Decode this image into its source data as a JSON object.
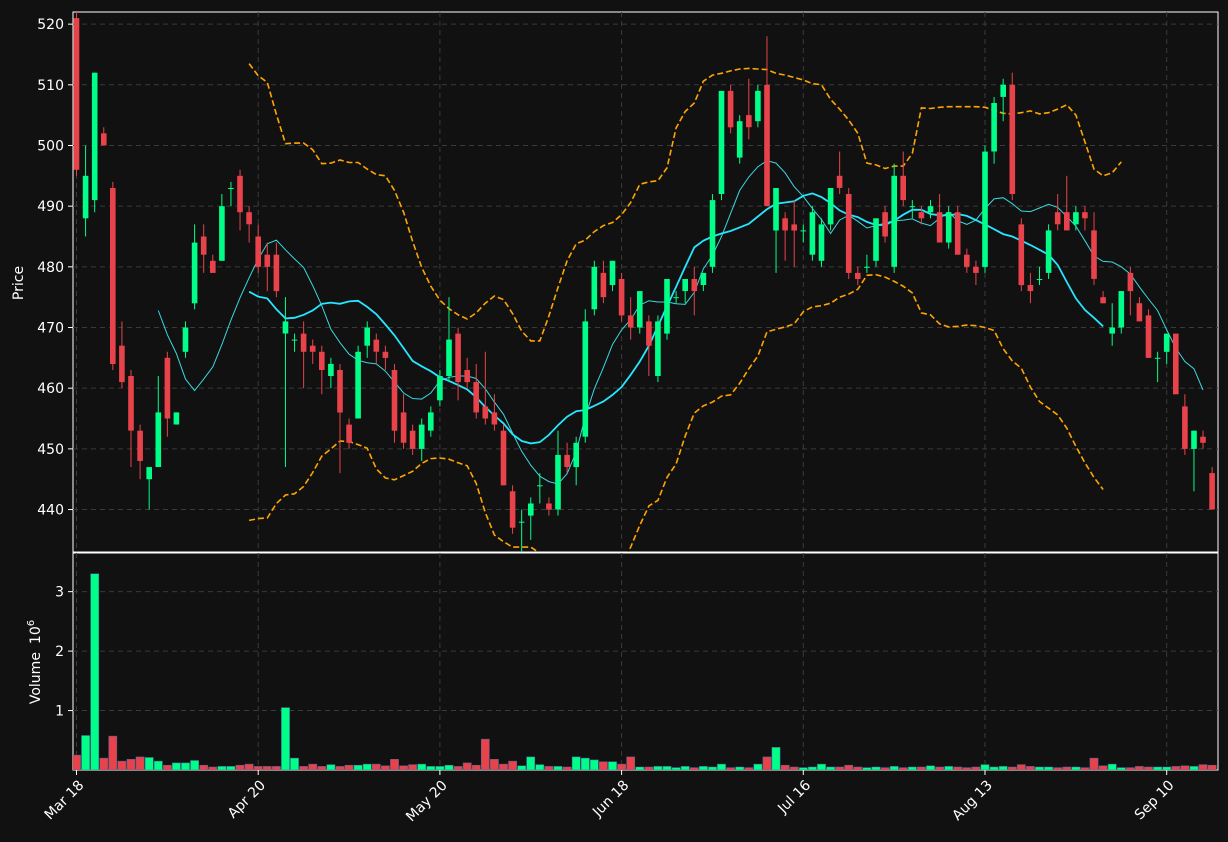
{
  "chart_data": {
    "type": "candlestick",
    "colors": {
      "background": "#111111",
      "up": "#00ff88",
      "down": "#e8434b",
      "ma_fast": "#3ad8e0",
      "ma_slow": "#27e6ff",
      "band": "#ffa500",
      "grid": "#3a3a3a",
      "axis": "#ffffff"
    },
    "price_panel": {
      "ylabel": "Price",
      "ylim": [
        433,
        522
      ],
      "yticks": [
        440,
        450,
        460,
        470,
        480,
        490,
        500,
        510,
        520
      ],
      "grid": true
    },
    "volume_panel": {
      "ylabel": "Volume",
      "ylabel_exponent": "6",
      "ylim": [
        0,
        3.65
      ],
      "yticks": [
        1,
        2,
        3
      ],
      "grid": true
    },
    "x_ticks": [
      {
        "index": 0,
        "label": "Mar 18"
      },
      {
        "index": 20,
        "label": "Apr 20"
      },
      {
        "index": 40,
        "label": "May 20"
      },
      {
        "index": 60,
        "label": "Jun 18"
      },
      {
        "index": 80,
        "label": "Jul 16"
      },
      {
        "index": 100,
        "label": "Aug 13"
      },
      {
        "index": 120,
        "label": "Sep 10"
      }
    ],
    "candles": [
      [
        521,
        522,
        495,
        496,
        0.25
      ],
      [
        488,
        500,
        485,
        495,
        0.58
      ],
      [
        491,
        512,
        489,
        512,
        3.3
      ],
      [
        502,
        503,
        500,
        500,
        0.2
      ],
      [
        493,
        494,
        463,
        464,
        0.57
      ],
      [
        467,
        471,
        460,
        461,
        0.15
      ],
      [
        462,
        463,
        447,
        453,
        0.18
      ],
      [
        453,
        454,
        445,
        448,
        0.22
      ],
      [
        445,
        447,
        440,
        447,
        0.21
      ],
      [
        447,
        462,
        447,
        456,
        0.15
      ],
      [
        465,
        466,
        452,
        455,
        0.08
      ],
      [
        454,
        456,
        454,
        456,
        0.12
      ],
      [
        466,
        471,
        465,
        470,
        0.12
      ],
      [
        474,
        487,
        473,
        484,
        0.16
      ],
      [
        485,
        487,
        479,
        482,
        0.08
      ],
      [
        481,
        482,
        479,
        479,
        0.05
      ],
      [
        481,
        492,
        481,
        490,
        0.06
      ],
      [
        493,
        494,
        490,
        493,
        0.06
      ],
      [
        495,
        496,
        486,
        489,
        0.08
      ],
      [
        489,
        490,
        484,
        487,
        0.1
      ],
      [
        485,
        487,
        479,
        480,
        0.06
      ],
      [
        482,
        484,
        476,
        480,
        0.06
      ],
      [
        482,
        484,
        475,
        476,
        0.06
      ],
      [
        469,
        475,
        447,
        471,
        1.05
      ],
      [
        468,
        469,
        466,
        468,
        0.2
      ],
      [
        469,
        471,
        460,
        466,
        0.06
      ],
      [
        467,
        468,
        464,
        466,
        0.1
      ],
      [
        466,
        467,
        459,
        463,
        0.06
      ],
      [
        462,
        465,
        460,
        464,
        0.09
      ],
      [
        463,
        464,
        446,
        456,
        0.06
      ],
      [
        454,
        455,
        450,
        451,
        0.08
      ],
      [
        455,
        467,
        455,
        466,
        0.08
      ],
      [
        467,
        471,
        465,
        470,
        0.1
      ],
      [
        468,
        469,
        464,
        466,
        0.1
      ],
      [
        466,
        467,
        463,
        465,
        0.07
      ],
      [
        463,
        464,
        451,
        453,
        0.18
      ],
      [
        456,
        459,
        450,
        451,
        0.07
      ],
      [
        453,
        454,
        449,
        450,
        0.09
      ],
      [
        450,
        455,
        448,
        454,
        0.1
      ],
      [
        453,
        457,
        452,
        456,
        0.06
      ],
      [
        458,
        463,
        457,
        462,
        0.06
      ],
      [
        462,
        475,
        461,
        468,
        0.08
      ],
      [
        469,
        470,
        458,
        461,
        0.06
      ],
      [
        463,
        465,
        460,
        461,
        0.12
      ],
      [
        461,
        464,
        455,
        456,
        0.08
      ],
      [
        457,
        466,
        454,
        455,
        0.52
      ],
      [
        456,
        459,
        453,
        454,
        0.18
      ],
      [
        453,
        454,
        444,
        444,
        0.1
      ],
      [
        443,
        444,
        436,
        437,
        0.15
      ],
      [
        438,
        440,
        433,
        438,
        0.07
      ],
      [
        439,
        442,
        435,
        441,
        0.22
      ],
      [
        444,
        446,
        441,
        444,
        0.09
      ],
      [
        441,
        442,
        439,
        440,
        0.06
      ],
      [
        440,
        453,
        439,
        449,
        0.06
      ],
      [
        449,
        451,
        446,
        447,
        0.05
      ],
      [
        447,
        452,
        444,
        451,
        0.22
      ],
      [
        452,
        473,
        451,
        471,
        0.2
      ],
      [
        473,
        481,
        472,
        480,
        0.17
      ],
      [
        479,
        481,
        474,
        475,
        0.14
      ],
      [
        477,
        481,
        476,
        481,
        0.14
      ],
      [
        478,
        479,
        471,
        472,
        0.1
      ],
      [
        472,
        475,
        468,
        470,
        0.22
      ],
      [
        470,
        476,
        469,
        476,
        0.05
      ],
      [
        471,
        472,
        462,
        467,
        0.05
      ],
      [
        462,
        472,
        461,
        471,
        0.06
      ],
      [
        469,
        478,
        468,
        478,
        0.06
      ],
      [
        475,
        476,
        474,
        475,
        0.04
      ],
      [
        476,
        478,
        474,
        478,
        0.06
      ],
      [
        478,
        480,
        472,
        476,
        0.04
      ],
      [
        477,
        479,
        476,
        479,
        0.06
      ],
      [
        480,
        492,
        479,
        491,
        0.05
      ],
      [
        492,
        509,
        491,
        509,
        0.1
      ],
      [
        509,
        510,
        502,
        503,
        0.04
      ],
      [
        498,
        505,
        497,
        504,
        0.05
      ],
      [
        505,
        511,
        501,
        503,
        0.04
      ],
      [
        504,
        510,
        503,
        509,
        0.1
      ],
      [
        510,
        518,
        490,
        490,
        0.22
      ],
      [
        486,
        493,
        479,
        493,
        0.38
      ],
      [
        488,
        489,
        481,
        486,
        0.08
      ],
      [
        487,
        491,
        480,
        486,
        0.05
      ],
      [
        486,
        487,
        484,
        486,
        0.04
      ],
      [
        482,
        490,
        481,
        489,
        0.05
      ],
      [
        481,
        488,
        480,
        487,
        0.1
      ],
      [
        487,
        492,
        486,
        493,
        0.05
      ],
      [
        495,
        499,
        492,
        493,
        0.05
      ],
      [
        492,
        493,
        478,
        479,
        0.08
      ],
      [
        479,
        480,
        477,
        478,
        0.05
      ],
      [
        480,
        482,
        479,
        480,
        0.04
      ],
      [
        481,
        488,
        480,
        488,
        0.05
      ],
      [
        489,
        490,
        484,
        485,
        0.04
      ],
      [
        480,
        497,
        479,
        495,
        0.06
      ],
      [
        495,
        499,
        490,
        491,
        0.04
      ],
      [
        490,
        491,
        488,
        490,
        0.05
      ],
      [
        489,
        490,
        487,
        488,
        0.05
      ],
      [
        489,
        491,
        488,
        490,
        0.07
      ],
      [
        489,
        492,
        484,
        484,
        0.05
      ],
      [
        484,
        490,
        483,
        489,
        0.06
      ],
      [
        489,
        490,
        482,
        482,
        0.05
      ],
      [
        482,
        483,
        479,
        480,
        0.04
      ],
      [
        480,
        481,
        477,
        479,
        0.05
      ],
      [
        480,
        500,
        479,
        499,
        0.09
      ],
      [
        499,
        508,
        497,
        507,
        0.05
      ],
      [
        508,
        511,
        504,
        510,
        0.06
      ],
      [
        510,
        512,
        491,
        492,
        0.05
      ],
      [
        487,
        488,
        476,
        477,
        0.09
      ],
      [
        477,
        479,
        474,
        476,
        0.06
      ],
      [
        478,
        480,
        477,
        478,
        0.05
      ],
      [
        479,
        487,
        478,
        486,
        0.05
      ],
      [
        489,
        492,
        486,
        487,
        0.04
      ],
      [
        489,
        495,
        486,
        486,
        0.05
      ],
      [
        487,
        490,
        486,
        489,
        0.05
      ],
      [
        489,
        490,
        486,
        488,
        0.04
      ],
      [
        486,
        489,
        477,
        478,
        0.2
      ],
      [
        475,
        476,
        474,
        474,
        0.07
      ],
      [
        469,
        474,
        467,
        470,
        0.1
      ],
      [
        470,
        476,
        469,
        476,
        0.04
      ],
      [
        479,
        480,
        472,
        476,
        0.04
      ],
      [
        474,
        475,
        471,
        471,
        0.06
      ],
      [
        472,
        473,
        465,
        465,
        0.05
      ],
      [
        465,
        466,
        461,
        465,
        0.05
      ],
      [
        466,
        469,
        464,
        469,
        0.05
      ],
      [
        469,
        469,
        459,
        459,
        0.06
      ],
      [
        457,
        459,
        449,
        450,
        0.07
      ],
      [
        450,
        453,
        443,
        453,
        0.06
      ],
      [
        452,
        453,
        450,
        451,
        0.09
      ],
      [
        446,
        447,
        440,
        440,
        0.08
      ]
    ],
    "ma_fast_start": 9,
    "ma_fast": [
      472.8,
      468.8,
      465.7,
      461.5,
      459.6,
      461.5,
      463.5,
      467.2,
      471.2,
      474.9,
      478.2,
      481.3,
      483.8,
      484.4,
      482.8,
      481.3,
      479.9,
      476.9,
      473.6,
      469.7,
      467.5,
      465.6,
      464.6,
      464.2,
      464.0,
      462.8,
      461.0,
      459.2,
      458.3,
      458.2,
      459.2,
      461.2,
      461.8,
      462.0,
      462.0,
      461.6,
      459.9,
      457.7,
      455.7,
      452.6,
      449.6,
      447.3,
      445.5,
      444.6,
      444.2,
      445.9,
      449.5,
      455.3,
      459.9,
      463.4,
      467.2,
      469.6,
      471.3,
      473.7,
      474.4,
      474.2,
      474.2,
      473.9,
      473.8,
      475.8,
      479.7,
      481.9,
      485.0,
      488.8,
      492.6,
      494.8,
      496.5,
      497.5,
      497.1,
      495.5,
      493.2,
      491.6,
      489.6,
      487.8,
      485.5,
      487.7,
      488.5,
      487.5,
      486.4,
      486.8,
      487.2,
      487.6,
      487.7,
      487.9,
      487.2,
      486.8,
      488.0,
      489.0,
      487.6,
      487.0,
      487.7,
      489.6,
      491.2,
      491.4,
      490.4,
      489.2,
      489.1,
      489.7,
      490.3,
      489.8,
      488.3,
      486.7,
      484.3,
      481.8,
      480.9,
      480.8,
      480.0,
      478.8,
      476.7,
      474.7,
      472.8,
      469.6,
      466.6,
      464.4,
      463.2,
      459.7
    ],
    "ma_slow_start": 19,
    "ma_slow": [
      475.9,
      475.1,
      474.8,
      473.0,
      471.5,
      471.6,
      472.1,
      472.8,
      473.9,
      474.1,
      473.9,
      474.3,
      474.4,
      473.4,
      472.2,
      470.5,
      468.7,
      466.6,
      464.5,
      463.6,
      462.8,
      461.8,
      461.2,
      460.5,
      459.8,
      458.5,
      456.9,
      455.5,
      454.2,
      452.4,
      451.3,
      450.9,
      451.1,
      452.3,
      453.9,
      455.3,
      456.2,
      456.4,
      457.1,
      457.8,
      458.9,
      460.2,
      462.2,
      464.4,
      467.0,
      470.2,
      473.5,
      476.7,
      480.0,
      483.2,
      484.3,
      485.0,
      485.5,
      485.9,
      486.5,
      487.1,
      488.3,
      489.5,
      490.4,
      490.6,
      490.8,
      491.7,
      492.1,
      491.5,
      490.5,
      489.3,
      488.6,
      488.2,
      487.4,
      486.9,
      486.9,
      487.6,
      488.6,
      489.4,
      489.4,
      488.7,
      488.5,
      488.5,
      488.7,
      488.4,
      487.7,
      487.0,
      486.2,
      485.4,
      485.0,
      484.3,
      483.6,
      482.8,
      482.0,
      480.3,
      477.5,
      474.8,
      472.9,
      471.6,
      470.2
    ],
    "band_start": 19,
    "band_upper": [
      513.5,
      511.5,
      510.4,
      505.1,
      500.3,
      500.4,
      500.4,
      499.3,
      497.0,
      497.1,
      497.6,
      497.2,
      497.2,
      496.1,
      495.2,
      495.0,
      492.6,
      489.0,
      484.2,
      479.9,
      476.8,
      474.5,
      473.1,
      472.1,
      471.4,
      472.4,
      474.0,
      475.2,
      474.6,
      472.3,
      469.4,
      467.8,
      467.8,
      471.9,
      476.6,
      481.0,
      483.8,
      484.4,
      485.8,
      486.8,
      487.3,
      488.6,
      490.6,
      493.6,
      494.0,
      494.2,
      496.3,
      502.9,
      505.6,
      507.0,
      510.6,
      511.6,
      511.9,
      512.3,
      512.6,
      512.7,
      512.6,
      512.5,
      511.9,
      511.6,
      511.2,
      510.8,
      510.2,
      510.0,
      507.6,
      506.0,
      504.2,
      502.0,
      497.1,
      496.8,
      496.2,
      496.6,
      496.6,
      498.7,
      506.2,
      506.1,
      506.3,
      506.4,
      506.4,
      506.4,
      506.4,
      506.3,
      505.8,
      505.3,
      505.2,
      505.4,
      505.7,
      505.2,
      505.4,
      506.0,
      506.7,
      505.0,
      500.6,
      496.1,
      495.0,
      495.5,
      497.3
    ],
    "band_lower": [
      438.2,
      438.5,
      438.6,
      441.0,
      442.4,
      442.6,
      443.8,
      446.1,
      448.8,
      450.0,
      451.3,
      451.2,
      450.7,
      450.1,
      446.7,
      445.2,
      444.9,
      445.6,
      446.3,
      447.6,
      448.4,
      448.5,
      448.3,
      447.7,
      447.2,
      444.3,
      439.5,
      435.8,
      434.7,
      433.8,
      433.8,
      433.8,
      432.8,
      430.8,
      429.0,
      428.0,
      427.4,
      426.8,
      426.9,
      427.9,
      428.6,
      430.8,
      433.8,
      437.4,
      440.6,
      441.5,
      445.3,
      447.5,
      452.1,
      455.9,
      457.1,
      457.7,
      458.7,
      458.9,
      460.8,
      463.2,
      465.3,
      469.3,
      469.7,
      470.1,
      470.6,
      472.6,
      473.4,
      473.6,
      474.0,
      475.0,
      475.5,
      476.3,
      478.6,
      478.7,
      478.3,
      477.6,
      476.8,
      475.7,
      472.4,
      472.1,
      470.6,
      470.1,
      470.2,
      470.4,
      470.3,
      470.0,
      469.5,
      466.5,
      464.5,
      463.3,
      460.2,
      457.8,
      456.7,
      455.6,
      453.4,
      450.4,
      447.7,
      445.3,
      443.3
    ]
  }
}
